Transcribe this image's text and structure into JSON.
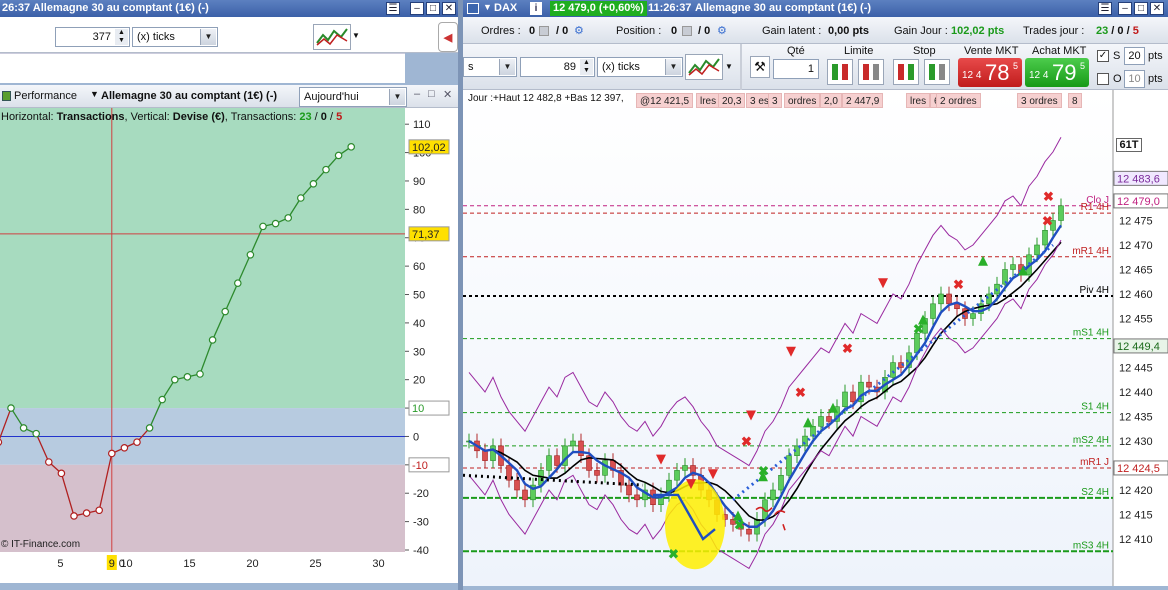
{
  "left_window": {
    "title": "26:37  Allemagne 30 au comptant (1€) (-)",
    "ticks_value": "377",
    "ticks_mode": "(x) ticks",
    "perf_tab": "Performance",
    "perf_instrument": "Allemagne 30 au comptant (1€) (-)",
    "period": "Aujourd'hui",
    "info_prefix": "Horizontal: ",
    "info_h": "Transactions",
    "info_mid": ", Vertical: ",
    "info_v": "Devise (€)",
    "info_tx": ", Transactions: ",
    "tx_green": "23",
    "tx_sep1": " / ",
    "tx_black": "0",
    "tx_sep2": " / ",
    "tx_red": "5",
    "copyright": "© IT-Finance.com",
    "current_value": "102,02",
    "cursor_value": "71,37",
    "cursor_x": "9",
    "band_top_label": "10",
    "band_bot_label": "-10",
    "y_ticks": [
      "110",
      "100",
      "90",
      "80",
      "70",
      "60",
      "50",
      "40",
      "30",
      "20",
      "10",
      "0",
      "-10",
      "-20",
      "-30",
      "-40"
    ],
    "x_ticks": [
      "5",
      "10",
      "15",
      "20",
      "25",
      "30"
    ],
    "x_zero": "0"
  },
  "chart_data": [
    {
      "type": "line",
      "title": "",
      "xlabel": "",
      "ylabel": "",
      "ylim": [
        -40,
        115
      ],
      "xlim": [
        0,
        32
      ],
      "x": [
        0,
        1,
        2,
        3,
        4,
        5,
        6,
        7,
        8,
        9,
        10,
        11,
        12,
        13,
        14,
        15,
        16,
        17,
        18,
        19,
        20,
        21,
        22,
        23,
        24,
        25,
        26,
        27,
        28
      ],
      "values": [
        -2,
        10,
        3,
        1,
        -9,
        -13,
        -28,
        -27,
        -26,
        -6,
        -4,
        -2,
        3,
        13,
        20,
        21,
        22,
        34,
        44,
        54,
        64,
        74,
        75,
        77,
        84,
        89,
        94,
        99,
        102.02
      ],
      "colors": {
        "positive": "#2d8a2d",
        "negative": "#b02020"
      },
      "grid": false
    }
  ],
  "right_window": {
    "title_name": "DAX",
    "title_price": "12 479,0 (+0,60%)",
    "title_time": "11:26:37",
    "title_instrument": "Allemagne 30 au comptant (1€) (-)",
    "orders_label": "Ordres :",
    "orders_val1": "0",
    "orders_val2": "/ 0",
    "position_label": "Position :",
    "position_val1": "0",
    "position_val2": "/ 0",
    "gain_latent_label": "Gain latent :",
    "gain_latent_value": "0,00 pts",
    "gain_jour_label": "Gain Jour :",
    "gain_jour_value": "102,02 pts",
    "trades_label": "Trades jour :",
    "trades_green": "23",
    "trades_sep1": " / ",
    "trades_black": "0",
    "trades_sep2": " / ",
    "trades_red": "5",
    "ticks_value": "89",
    "ticks_mode": "(x) ticks",
    "qty_label": "Qté",
    "qty_value": "1",
    "limit_label": "Limite",
    "stop_label": "Stop",
    "sell_label": "Vente MKT",
    "sell_small": "12 4",
    "sell_big": "78",
    "sell_sup": "5",
    "buy_label": "Achat MKT",
    "buy_small": "12 4",
    "buy_big": "79",
    "buy_sup": "5",
    "s_label": "S",
    "s_value": "20",
    "o_label": "O",
    "o_value": "10",
    "pts": "pts",
    "scroll_text": "s",
    "info_day": "Jour :+Haut 12 482,8 +Bas 12 397,",
    "info_segs": [
      "@12 421,5",
      "lres",
      "20,3",
      "3 es",
      "3",
      "ordres",
      "2,0",
      "2 447,9",
      "lres",
      "6,5",
      "2 ordres",
      "3 ordres",
      "8"
    ],
    "y_ticks": [
      "12 475",
      "12 470",
      "12 465",
      "12 460",
      "12 455",
      "12 450",
      "12 445",
      "12 440",
      "12 435",
      "12 430",
      "12 425",
      "12 420",
      "12 415",
      "12 410"
    ],
    "price_boxes": {
      "high": "12 483,6",
      "close": "12 479,0",
      "ms1": "12 449,4",
      "mr1": "12 424,5"
    },
    "tick_counter": "61T",
    "levels": {
      "clo": "Clo J",
      "r1": "R1 4H",
      "mr1": "mR1 4H",
      "piv": "Piv 4H",
      "ms1": "mS1 4H",
      "s1": "S1 4H",
      "ms2": "mS2 4H",
      "mr1j": "mR1 J",
      "s2": "S2 4H",
      "ms3": "mS3 4H"
    }
  }
}
